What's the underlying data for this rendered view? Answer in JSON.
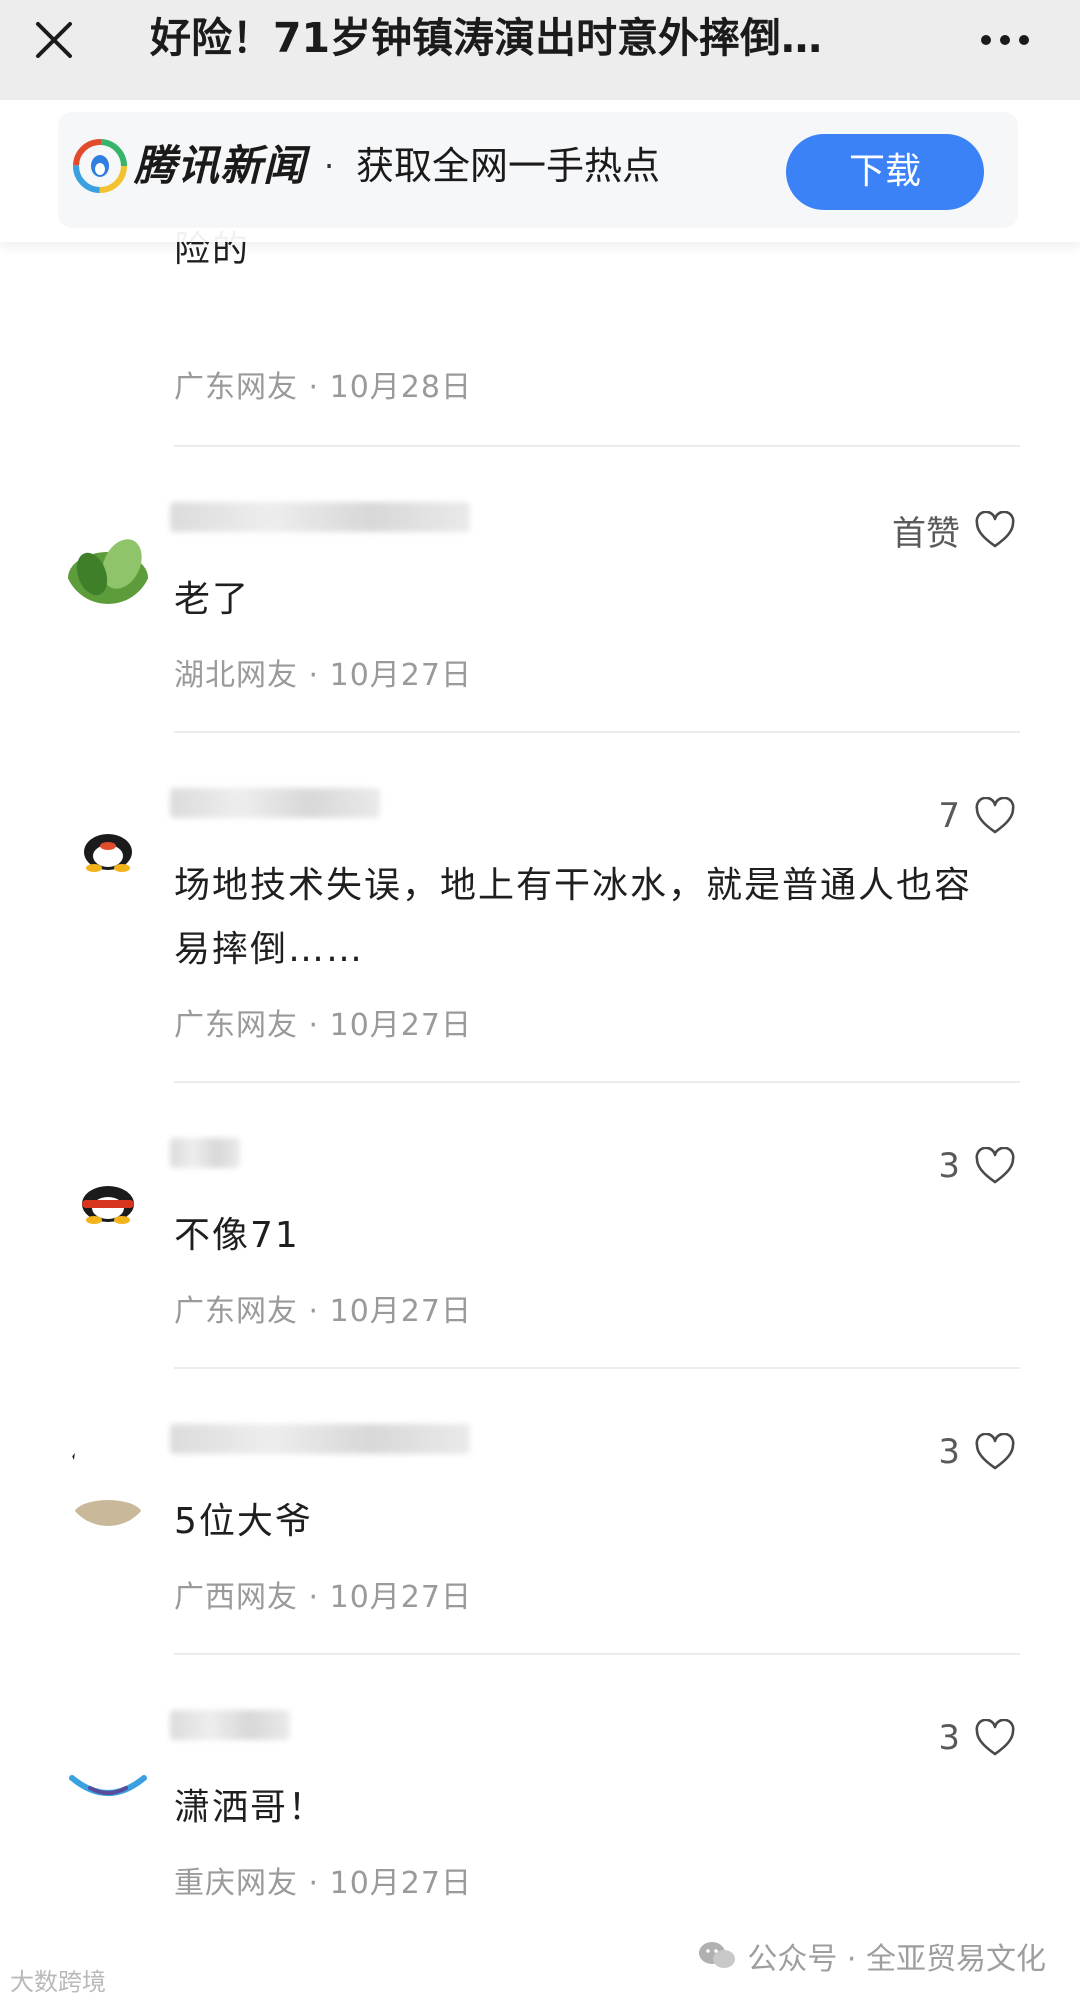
{
  "header": {
    "title": "好险！71岁钟镇涛演出时意外摔倒…",
    "close_icon": "close-icon",
    "more_icon": "more-dots-icon"
  },
  "banner": {
    "brand": "腾讯新闻",
    "separator": "·",
    "slogan": "获取全网一手热点",
    "download_label": "下载",
    "accent_color": "#3b82f6"
  },
  "partial_comment": {
    "text": "险的",
    "meta": "广东网友 · 10月28日"
  },
  "comments": [
    {
      "like_label": "首赞",
      "text": "老了",
      "meta": "湖北网友 · 10月27日"
    },
    {
      "like_label": "7",
      "text": "场地技术失误，地上有干冰水，就是普通人也容易摔倒……",
      "meta": "广东网友 · 10月27日"
    },
    {
      "like_label": "3",
      "text": "不像71",
      "meta": "广东网友 · 10月27日"
    },
    {
      "like_label": "3",
      "text": "5位大爷",
      "meta": "广西网友 · 10月27日"
    },
    {
      "like_label": "3",
      "text": "潇洒哥！",
      "meta": "重庆网友 · 10月27日"
    }
  ],
  "watermark": {
    "left": "大数跨境",
    "right": "公众号 · 全亚贸易文化"
  }
}
